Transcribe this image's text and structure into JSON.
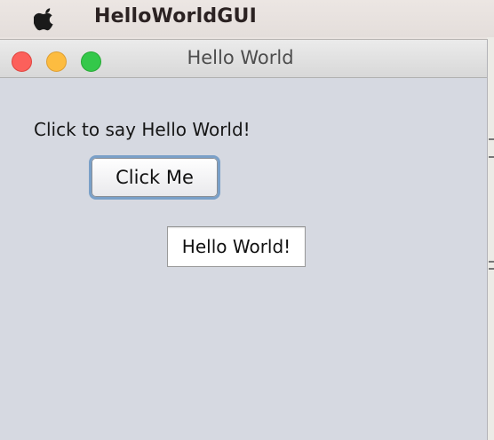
{
  "menubar": {
    "apple_icon": "apple-logo-icon",
    "app_name": "HelloWorldGUI"
  },
  "window": {
    "title": "Hello World",
    "traffic_lights": {
      "close_color": "#fc605b",
      "minimize_color": "#fdbc40",
      "zoom_color": "#34c84a"
    },
    "content": {
      "prompt_label": "Click to say Hello World!",
      "button_label": "Click Me",
      "output_value": "Hello World!"
    }
  },
  "colors": {
    "window_background": "#d6d9e1",
    "button_focus_ring": "#7aa0c8"
  }
}
